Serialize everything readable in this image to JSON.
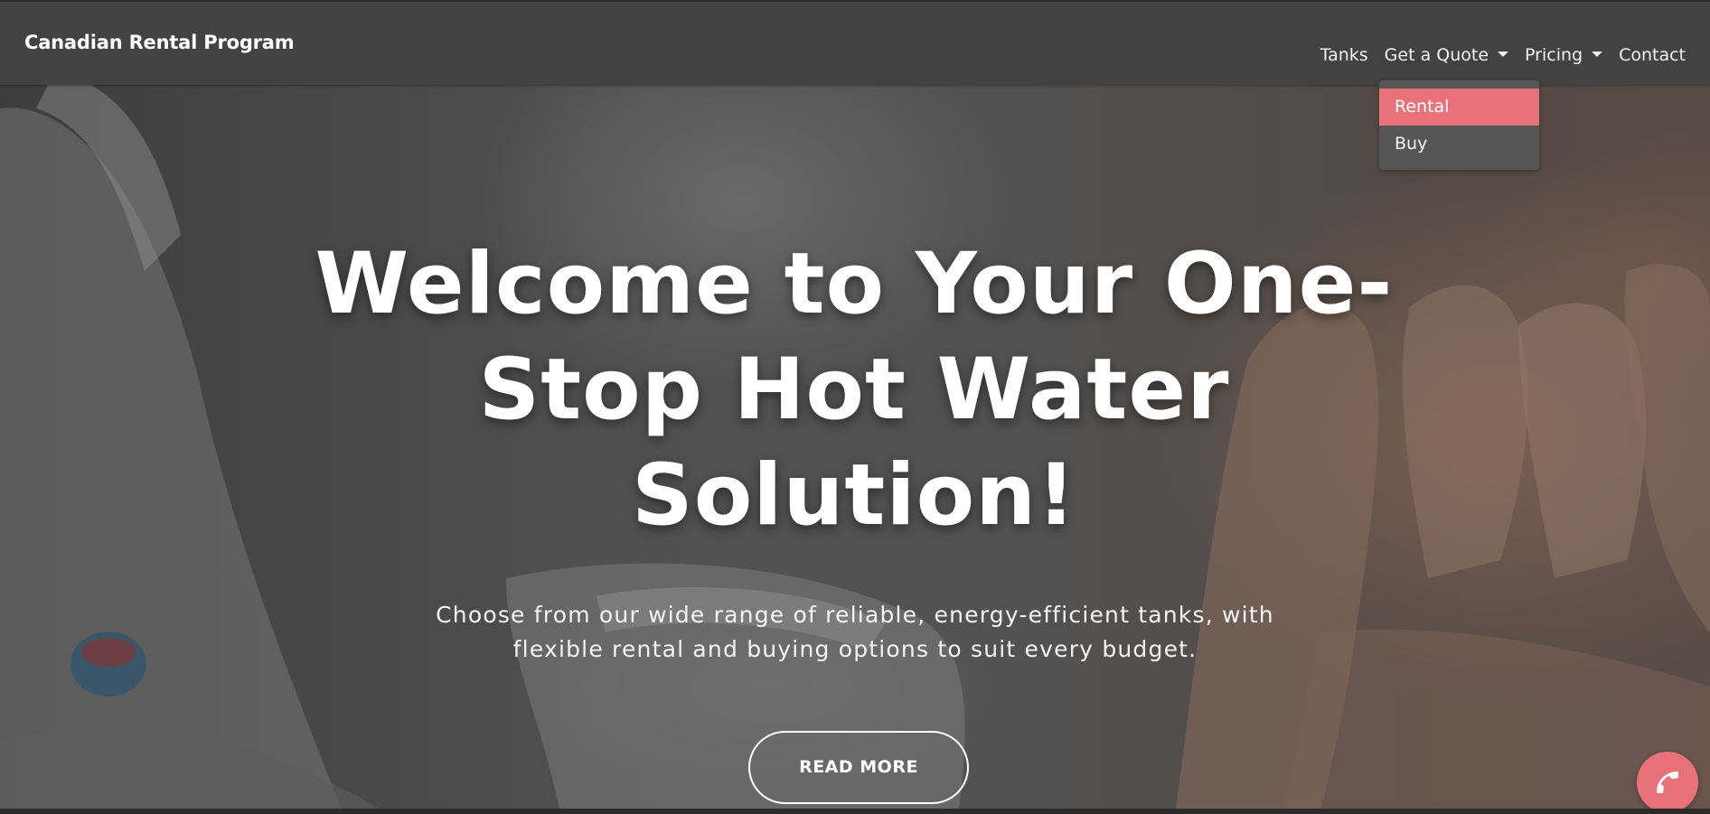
{
  "navbar": {
    "brand": "Canadian Rental Program",
    "items": [
      {
        "label": "Tanks"
      },
      {
        "label": "Get a Quote"
      },
      {
        "label": "Pricing"
      },
      {
        "label": "Contact"
      }
    ],
    "dropdown": {
      "items": [
        {
          "label": "Rental",
          "highlighted": true
        },
        {
          "label": "Buy",
          "highlighted": false
        }
      ]
    }
  },
  "hero": {
    "title": "Welcome to Your One-Stop Hot Water Solution!",
    "subtitle": "Choose from our wide range of reliable, energy-efficient tanks, with flexible rental and buying options to suit every budget.",
    "cta_label": "READ MORE"
  },
  "floating": {
    "icon": "phone-icon"
  },
  "colors": {
    "navbar_bg": "#424242",
    "accent": "#e9717a",
    "dropdown_bg": "#565656",
    "text": "#ffffff"
  }
}
